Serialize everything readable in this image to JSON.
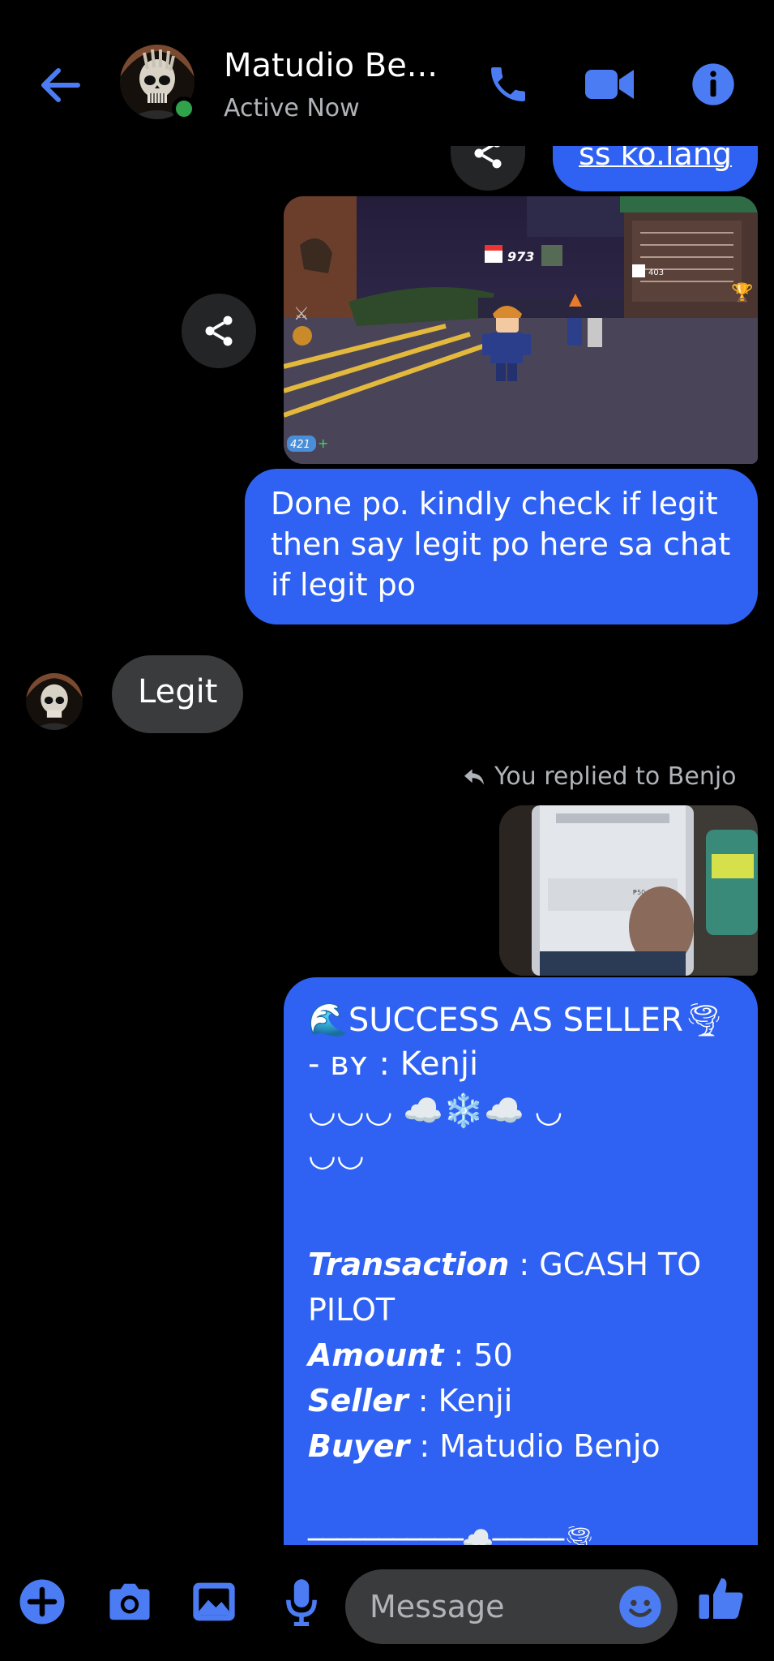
{
  "header": {
    "contact_name": "Matudio Be...",
    "status": "Active Now"
  },
  "messages": {
    "top_partial": "ss ko.lang",
    "outgoing_text": [
      "Done po. kindly check if legit",
      "then say legit po here sa chat",
      "if legit po"
    ],
    "incoming_text": "Legit",
    "reply_label": "You replied to Benjo"
  },
  "game_screenshot": {
    "counter": "973",
    "small_counter": "403",
    "gems": "421"
  },
  "phone_photo": {
    "amount": "₱50.00"
  },
  "seller_card": {
    "line1_text": "SUCCESS AS SELLER",
    "line1_lead": "🌊",
    "line1_trail": "🌪",
    "line2": "- ʙʏ : Kenji",
    "line3": "◡◡◡ ☁️❄️☁️ ◡",
    "line4": "◡◡",
    "transaction_label": "Transaction",
    "transaction_value": " : GCASH TO PILOT",
    "amount_label": "Amount",
    "amount_value": " : 50",
    "seller_label": "Seller",
    "seller_value": " : Kenji",
    "buyer_label": "Buyer",
    "buyer_value": " : Matudio Benjo",
    "footer_line": "───────────☁️─────🌪"
  },
  "composer": {
    "placeholder": "Message"
  },
  "colors": {
    "accent": "#2f62f3",
    "icon_blue": "#4c7cf3",
    "incoming_bubble": "#3a3b3c",
    "online": "#31a24c"
  },
  "icons": [
    "back-arrow-icon",
    "phone-icon",
    "video-camera-icon",
    "info-icon",
    "share-icon",
    "reply-icon",
    "plus-icon",
    "camera-icon",
    "image-icon",
    "microphone-icon",
    "emoji-icon",
    "thumbs-up-icon"
  ]
}
